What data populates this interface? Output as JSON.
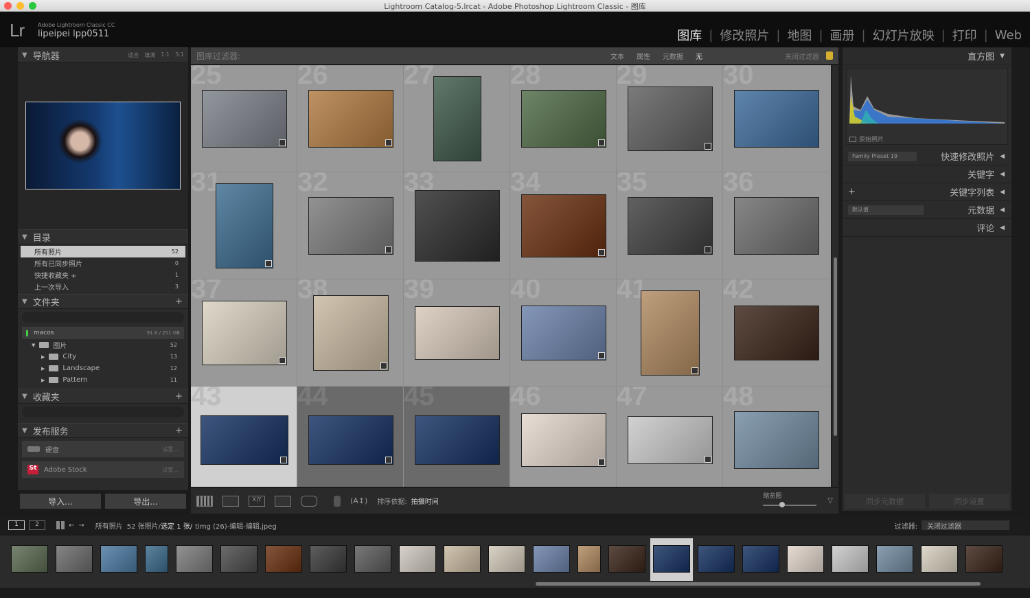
{
  "window": {
    "title": "Lightroom Catalog-5.lrcat - Adobe Photoshop Lightroom Classic - 图库"
  },
  "identity": {
    "logo": "Lr",
    "app_name": "Adobe Lightroom Classic CC",
    "user": "lipeipei lpp0511"
  },
  "modules": [
    {
      "label": "图库",
      "active": true
    },
    {
      "label": "修改照片"
    },
    {
      "label": "地图"
    },
    {
      "label": "画册"
    },
    {
      "label": "幻灯片放映"
    },
    {
      "label": "打印"
    },
    {
      "label": "Web"
    }
  ],
  "navigator": {
    "title": "导航器",
    "zoom": [
      "适合",
      "填满",
      "1:1",
      "3:1"
    ]
  },
  "catalog": {
    "title": "目录",
    "items": [
      {
        "label": "所有照片",
        "count": "52"
      },
      {
        "label": "所有已同步照片",
        "count": "0"
      },
      {
        "label": "快捷收藏夹 +",
        "count": "1"
      },
      {
        "label": "上一次导入",
        "count": "3"
      }
    ]
  },
  "folders": {
    "title": "文件夹",
    "volume": "macos",
    "volume_size": "91.8 / 251 GB",
    "items": [
      {
        "label": "图片",
        "count": "52"
      },
      {
        "label": "City",
        "count": "13"
      },
      {
        "label": "Landscape",
        "count": "12"
      },
      {
        "label": "Pattern",
        "count": "11"
      }
    ]
  },
  "collections": {
    "title": "收藏夹"
  },
  "publish": {
    "title": "发布服务",
    "items": [
      {
        "label": "硬盘",
        "action": "设置..."
      },
      {
        "label": "Adobe Stock",
        "action": "设置..."
      }
    ]
  },
  "left_buttons": {
    "import": "导入...",
    "export": "导出..."
  },
  "filter_bar": {
    "label": "图库过滤器:",
    "tabs": [
      "文本",
      "属性",
      "元数据",
      "无"
    ],
    "close": "关闭过滤器"
  },
  "grid": {
    "cells": [
      {
        "n": "25",
        "c": "#7b8088"
      },
      {
        "n": "26",
        "c": "#b07a40"
      },
      {
        "n": "27",
        "c": "#3f5a4a"
      },
      {
        "n": "28",
        "c": "#4f6a45"
      },
      {
        "n": "29",
        "c": "#5d5d5d"
      },
      {
        "n": "30",
        "c": "#3c6a9a"
      },
      {
        "n": "31",
        "c": "#3c6c90"
      },
      {
        "n": "32",
        "c": "#7a7a7a"
      },
      {
        "n": "33",
        "c": "#2a2a2a"
      },
      {
        "n": "34",
        "c": "#6a3010"
      },
      {
        "n": "35",
        "c": "#3e3e3e"
      },
      {
        "n": "36",
        "c": "#6c6c6c"
      },
      {
        "n": "37",
        "c": "#d8d0c0"
      },
      {
        "n": "38",
        "c": "#c8b8a0"
      },
      {
        "n": "39",
        "c": "#d6c8b8"
      },
      {
        "n": "40",
        "c": "#6a80a8"
      },
      {
        "n": "41",
        "c": "#b08a60"
      },
      {
        "n": "42",
        "c": "#3a2418"
      },
      {
        "n": "43",
        "c": "#143060"
      },
      {
        "n": "44",
        "c": "#143060"
      },
      {
        "n": "45",
        "c": "#143060"
      },
      {
        "n": "46",
        "c": "#e2d6cc"
      },
      {
        "n": "47",
        "c": "#c8c8c8"
      },
      {
        "n": "48",
        "c": "#708aa0"
      }
    ]
  },
  "toolbar": {
    "sort_label": "排序依据:",
    "sort_value": "拍摄时间",
    "thumb_label": "缩览图"
  },
  "right": {
    "histogram": "直方图",
    "original": "原始照片",
    "quick_dev": "快速修改照片",
    "preset": "Family Preset 19",
    "keywords": "关键字",
    "keyword_list": "关键字列表",
    "metadata": "元数据",
    "metadata_preset": "默认值",
    "comments": "评论",
    "sync_meta": "同步元数据",
    "sync_settings": "同步设置"
  },
  "filmstrip_bar": {
    "views": [
      "1",
      "2"
    ],
    "source": "所有照片",
    "info": "52 张照片/",
    "selected": "选定 1 张/",
    "file": "timg (26)-编辑-编辑.jpeg",
    "filter_label": "过滤器:",
    "filter_value": "关闭过滤器"
  },
  "filmstrip": {
    "colors": [
      "#5a6a50",
      "#6a6a6a",
      "#4a78a0",
      "#3a6a8a",
      "#7a7a7a",
      "#4a4a4a",
      "#6a3010",
      "#3a3a3a",
      "#5a5a5a",
      "#d0c8c0",
      "#c8b8a0",
      "#d0c8b8",
      "#6a80a8",
      "#b08a60",
      "#3a2418",
      "#143060",
      "#143060",
      "#143060",
      "#e0d4ca",
      "#c8c8c8",
      "#708aa0",
      "#d8d0c0",
      "#3a2418"
    ]
  }
}
